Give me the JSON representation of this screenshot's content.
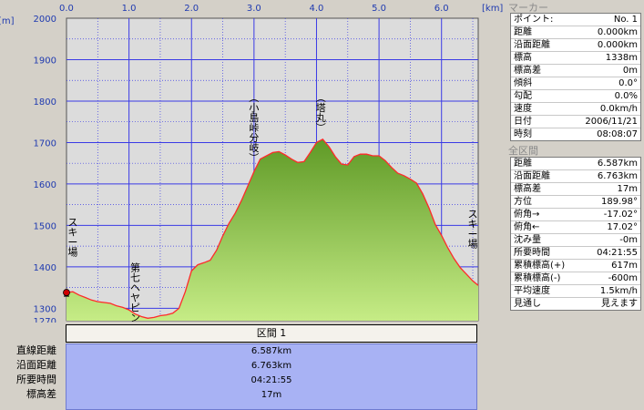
{
  "chart_data": {
    "type": "area",
    "title": "",
    "xlabel": "",
    "ylabel": "",
    "x_unit": "[km]",
    "y_unit": "[m]",
    "xlim": [
      0,
      6.587
    ],
    "ylim": [
      1270,
      2000
    ],
    "x_ticks": [
      "0.0",
      "1.0",
      "2.0",
      "3.0",
      "4.0",
      "5.0",
      "6.0"
    ],
    "y_ticks": [
      "2000",
      "1900",
      "1800",
      "1700",
      "1600",
      "1500",
      "1400",
      "1300",
      "1270"
    ],
    "series": [
      {
        "name": "",
        "x": [
          0.0,
          0.1,
          0.2,
          0.3,
          0.4,
          0.5,
          0.6,
          0.7,
          0.8,
          0.9,
          1.0,
          1.1,
          1.2,
          1.3,
          1.4,
          1.5,
          1.6,
          1.7,
          1.8,
          1.9,
          2.0,
          2.1,
          2.2,
          2.3,
          2.4,
          2.5,
          2.6,
          2.7,
          2.8,
          2.9,
          3.0,
          3.1,
          3.2,
          3.3,
          3.4,
          3.5,
          3.6,
          3.7,
          3.8,
          3.9,
          4.0,
          4.1,
          4.2,
          4.3,
          4.4,
          4.5,
          4.6,
          4.7,
          4.8,
          4.9,
          5.0,
          5.1,
          5.2,
          5.3,
          5.4,
          5.5,
          5.6,
          5.7,
          5.8,
          5.9,
          6.0,
          6.1,
          6.2,
          6.3,
          6.4,
          6.5,
          6.587
        ],
        "y": [
          1338,
          1340,
          1332,
          1326,
          1320,
          1316,
          1314,
          1312,
          1306,
          1302,
          1296,
          1286,
          1280,
          1276,
          1278,
          1282,
          1284,
          1288,
          1300,
          1340,
          1390,
          1405,
          1410,
          1416,
          1440,
          1475,
          1505,
          1530,
          1560,
          1595,
          1630,
          1660,
          1668,
          1676,
          1678,
          1670,
          1660,
          1652,
          1654,
          1676,
          1700,
          1708,
          1690,
          1666,
          1648,
          1646,
          1666,
          1672,
          1672,
          1668,
          1668,
          1656,
          1640,
          1626,
          1620,
          1612,
          1602,
          1576,
          1542,
          1502,
          1476,
          1446,
          1420,
          1398,
          1382,
          1366,
          1355
        ]
      }
    ],
    "annotations": [
      {
        "text": "スキー場",
        "x": 0.1,
        "y": 1500
      },
      {
        "text": "第七ヘヤピン",
        "x": 1.1,
        "y": 1390
      },
      {
        "text": "（小島峠分岐）",
        "x": 3.0,
        "y": 1800
      },
      {
        "text": "（塔丸）",
        "x": 4.07,
        "y": 1800
      },
      {
        "text": "スキー場",
        "x": 6.5,
        "y": 1520
      }
    ],
    "marker": {
      "x": 0.0,
      "y": 1338
    }
  },
  "summary": {
    "header": "区間 1",
    "rows": [
      {
        "label": "直線距離",
        "value": "6.587km"
      },
      {
        "label": "沿面距離",
        "value": "6.763km"
      },
      {
        "label": "所要時間",
        "value": "04:21:55"
      },
      {
        "label": "標高差",
        "value": "17m"
      }
    ]
  },
  "marker_panel": {
    "title": "マーカー",
    "rows": [
      {
        "label": "ポイント:",
        "value": "No. 1"
      },
      {
        "label": "距離",
        "value": "0.000km"
      },
      {
        "label": "沿面距離",
        "value": "0.000km"
      },
      {
        "label": "標高",
        "value": "1338m"
      },
      {
        "label": "標高差",
        "value": "0m"
      },
      {
        "label": "傾斜",
        "value": "0.0°"
      },
      {
        "label": "勾配",
        "value": "0.0%"
      },
      {
        "label": "速度",
        "value": "0.0km/h"
      },
      {
        "label": "日付",
        "value": "2006/11/21"
      },
      {
        "label": "時刻",
        "value": "08:08:07"
      }
    ]
  },
  "section_panel": {
    "title": "全区間",
    "rows": [
      {
        "label": "距離",
        "value": "6.587km"
      },
      {
        "label": "沿面距離",
        "value": "6.763km"
      },
      {
        "label": "標高差",
        "value": "17m"
      },
      {
        "label": "方位",
        "value": "189.98°"
      },
      {
        "label": "俯角→",
        "value": "-17.02°"
      },
      {
        "label": "俯角←",
        "value": "17.02°"
      },
      {
        "label": "沈み量",
        "value": "-0m"
      },
      {
        "label": "所要時間",
        "value": "04:21:55"
      },
      {
        "label": "累積標高(+)",
        "value": "617m"
      },
      {
        "label": "累積標高(-)",
        "value": "-600m"
      },
      {
        "label": "平均速度",
        "value": "1.5km/h"
      },
      {
        "label": "見通し",
        "value": "見えます"
      }
    ]
  },
  "colors": {
    "plot_bg": "#dcdcdc",
    "grid_major": "#3a3ae6",
    "grid_minor": "#3a3ae6",
    "profile_line": "#ff2a2a",
    "fill_top": "#5f9a26",
    "fill_bottom": "#c6ec86",
    "axis_text": "#1f3ab0",
    "marker": "#d00000"
  }
}
